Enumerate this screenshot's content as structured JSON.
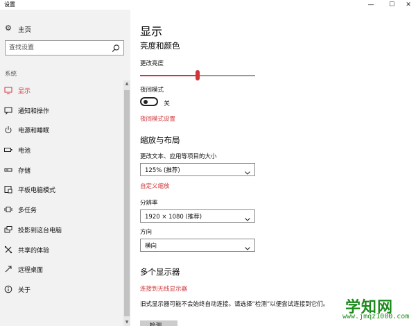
{
  "window": {
    "title": "设置",
    "minimize": "—",
    "maximize": "☐",
    "close": "✕"
  },
  "sidebar": {
    "home_label": "主页",
    "search_placeholder": "查找设置",
    "section": "系统",
    "items": [
      {
        "label": "显示",
        "icon": "monitor-icon",
        "active": true
      },
      {
        "label": "通知和操作",
        "icon": "message-icon"
      },
      {
        "label": "电源和睡眠",
        "icon": "power-icon"
      },
      {
        "label": "电池",
        "icon": "battery-icon"
      },
      {
        "label": "存储",
        "icon": "storage-icon"
      },
      {
        "label": "平板电脑模式",
        "icon": "tablet-icon"
      },
      {
        "label": "多任务",
        "icon": "multitask-icon"
      },
      {
        "label": "投影到这台电脑",
        "icon": "project-icon"
      },
      {
        "label": "共享的体验",
        "icon": "share-icon"
      },
      {
        "label": "远程桌面",
        "icon": "remote-icon"
      },
      {
        "label": "关于",
        "icon": "info-icon"
      }
    ]
  },
  "main": {
    "title": "显示",
    "brightness_section": "亮度和颜色",
    "brightness_label": "更改亮度",
    "brightness_value": 0.5,
    "night_label": "夜间模式",
    "night_state": "关",
    "night_link": "夜间模式设置",
    "scale_section": "缩放与布局",
    "scale_label": "更改文本、应用等项目的大小",
    "scale_value": "125% (推荐)",
    "custom_scale_link": "自定义缩放",
    "resolution_label": "分辨率",
    "resolution_value": "1920 × 1080 (推荐)",
    "orientation_label": "方向",
    "orientation_value": "横向",
    "multi_section": "多个显示器",
    "wireless_link": "连接到无线显示器",
    "legacy_text": "旧式显示器可能不会始终自动连接。请选择“检测”以便尝试连接到它们。",
    "detect_button": "检测"
  },
  "watermark": {
    "main": "学知网",
    "sub": "www.jmqz1000.com"
  },
  "colors": {
    "accent": "#d13438",
    "sidebar_bg": "#f2f2f2",
    "watermark": "#1c8a1c"
  }
}
